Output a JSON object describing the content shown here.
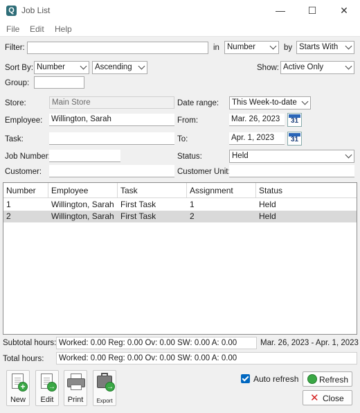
{
  "window": {
    "title": "Job List",
    "app_icon_glyph": "Q",
    "minimize_glyph": "—",
    "maximize_glyph": "☐",
    "close_glyph": "✕"
  },
  "menu": [
    "File",
    "Edit",
    "Help"
  ],
  "filter": {
    "label": "Filter:",
    "value": "",
    "in_label": "in",
    "in_value": "Number",
    "by_label": "by",
    "by_value": "Starts With"
  },
  "sort": {
    "label": "Sort By:",
    "field": "Number",
    "order": "Ascending",
    "show_label": "Show:",
    "show_value": "Active Only"
  },
  "group": {
    "label": "Group:",
    "value": ""
  },
  "fields": {
    "store_label": "Store:",
    "store_value": "Main Store",
    "employee_label": "Employee:",
    "employee_value": "Willington, Sarah",
    "task_label": "Task:",
    "task_value": "",
    "job_number_label": "Job Number:",
    "job_number_value": "",
    "customer_label": "Customer:",
    "customer_value": "",
    "date_range_label": "Date range:",
    "date_range_value": "This Week-to-date",
    "from_label": "From:",
    "from_value": "Mar. 26, 2023",
    "to_label": "To:",
    "to_value": "Apr. 1, 2023",
    "status_label": "Status:",
    "status_value": "Held",
    "customer_unit_label": "Customer Unit:",
    "customer_unit_value": "",
    "calendar_glyph": "31"
  },
  "table": {
    "columns": [
      "Number",
      "Employee",
      "Task",
      "Assignment",
      "Status"
    ],
    "rows": [
      [
        "1",
        "Willington, Sarah",
        "First Task",
        "1",
        "Held"
      ],
      [
        "2",
        "Willington, Sarah",
        "First Task",
        "2",
        "Held"
      ]
    ],
    "selected_row": 1
  },
  "summary": {
    "subtotal_label": "Subtotal hours:",
    "subtotal_value": "Worked: 0.00  Reg: 0.00  Ov: 0.00  SW: 0.00  A: 0.00",
    "subtotal_range": "Mar. 26, 2023 - Apr. 1, 2023",
    "total_label": "Total hours:",
    "total_value": "Worked: 0.00  Reg: 0.00  Ov: 0.00  SW: 0.00  A: 0.00"
  },
  "toolbar": {
    "new": "New",
    "edit": "Edit",
    "print": "Print",
    "export": "Export",
    "plus_glyph": "+",
    "arrow_glyph": "→"
  },
  "actions": {
    "auto_refresh_label": "Auto refresh",
    "auto_refresh_checked": true,
    "refresh": "Refresh",
    "close": "Close",
    "close_glyph": "✕"
  },
  "colors": {
    "accent": "#0067c0",
    "selected_row": "#d9d9d9"
  }
}
